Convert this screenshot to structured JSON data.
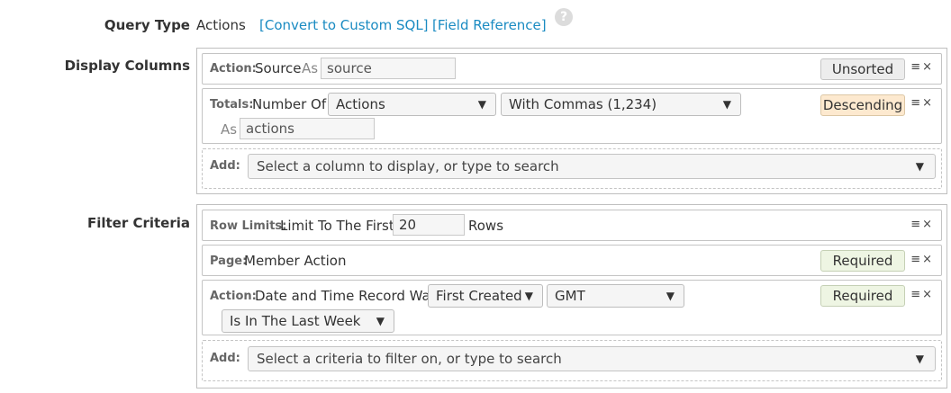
{
  "query_type": {
    "label": "Query Type",
    "value": "Actions",
    "convert_link": "[Convert to Custom SQL]",
    "field_reference_link": "[Field Reference]",
    "help_glyph": "?"
  },
  "display_columns": {
    "label": "Display Columns",
    "source_row": {
      "prefix": "Action:",
      "field": "Source",
      "as_label": "As",
      "alias_value": "source",
      "sort_label": "Unsorted"
    },
    "totals_row": {
      "prefix": "Totals:",
      "field": "Number Of",
      "count_select": "Actions",
      "format_select": "With Commas (1,234)",
      "as_label": "As",
      "alias_value": "actions",
      "sort_label": "Descending"
    },
    "add_row": {
      "prefix": "Add:",
      "placeholder": "Select a column to display, or type to search"
    }
  },
  "filter_criteria": {
    "label": "Filter Criteria",
    "row_limits": {
      "prefix": "Row Limits:",
      "text": "Limit To The First",
      "limit_value": "20",
      "suffix": "Rows"
    },
    "page_row": {
      "prefix": "Page:",
      "text": "Member Action",
      "status": "Required"
    },
    "date_row": {
      "prefix": "Action:",
      "text": "Date and Time Record Was",
      "created_select": "First Created",
      "timezone_select": "GMT",
      "range_select": "Is In The Last Week",
      "status": "Required"
    },
    "add_row": {
      "prefix": "Add:",
      "placeholder": "Select a criteria to filter on, or type to search"
    }
  },
  "controls": {
    "menu_glyph": "≡",
    "close_glyph": "×",
    "dropdown_glyph": "▼"
  }
}
